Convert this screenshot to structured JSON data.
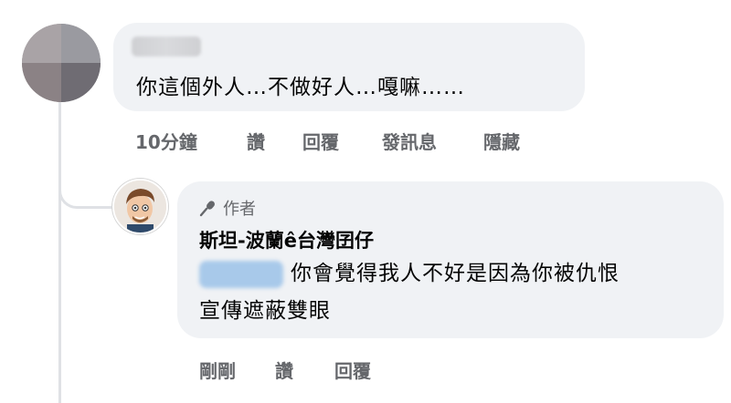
{
  "comment": {
    "text": "你這個外人…不做好人…嘎嘛……",
    "actions": {
      "time": "10分鐘",
      "like": "讚",
      "reply": "回覆",
      "message": "發訊息",
      "hide": "隱藏"
    }
  },
  "reply": {
    "badge_label": "作者",
    "badge_icon": "microphone-icon",
    "author_name": "斯坦-波蘭ê台灣囝仔",
    "text_line1": "你會覺得我人不好是因為你被仇恨",
    "text_line2": "宣傳遮蔽雙眼",
    "actions": {
      "time": "剛剛",
      "like": "讚",
      "reply": "回覆"
    }
  },
  "colors": {
    "bubble_bg": "#f0f2f5",
    "action_text": "#65676b",
    "mention_highlight": "#a8c9ea"
  }
}
